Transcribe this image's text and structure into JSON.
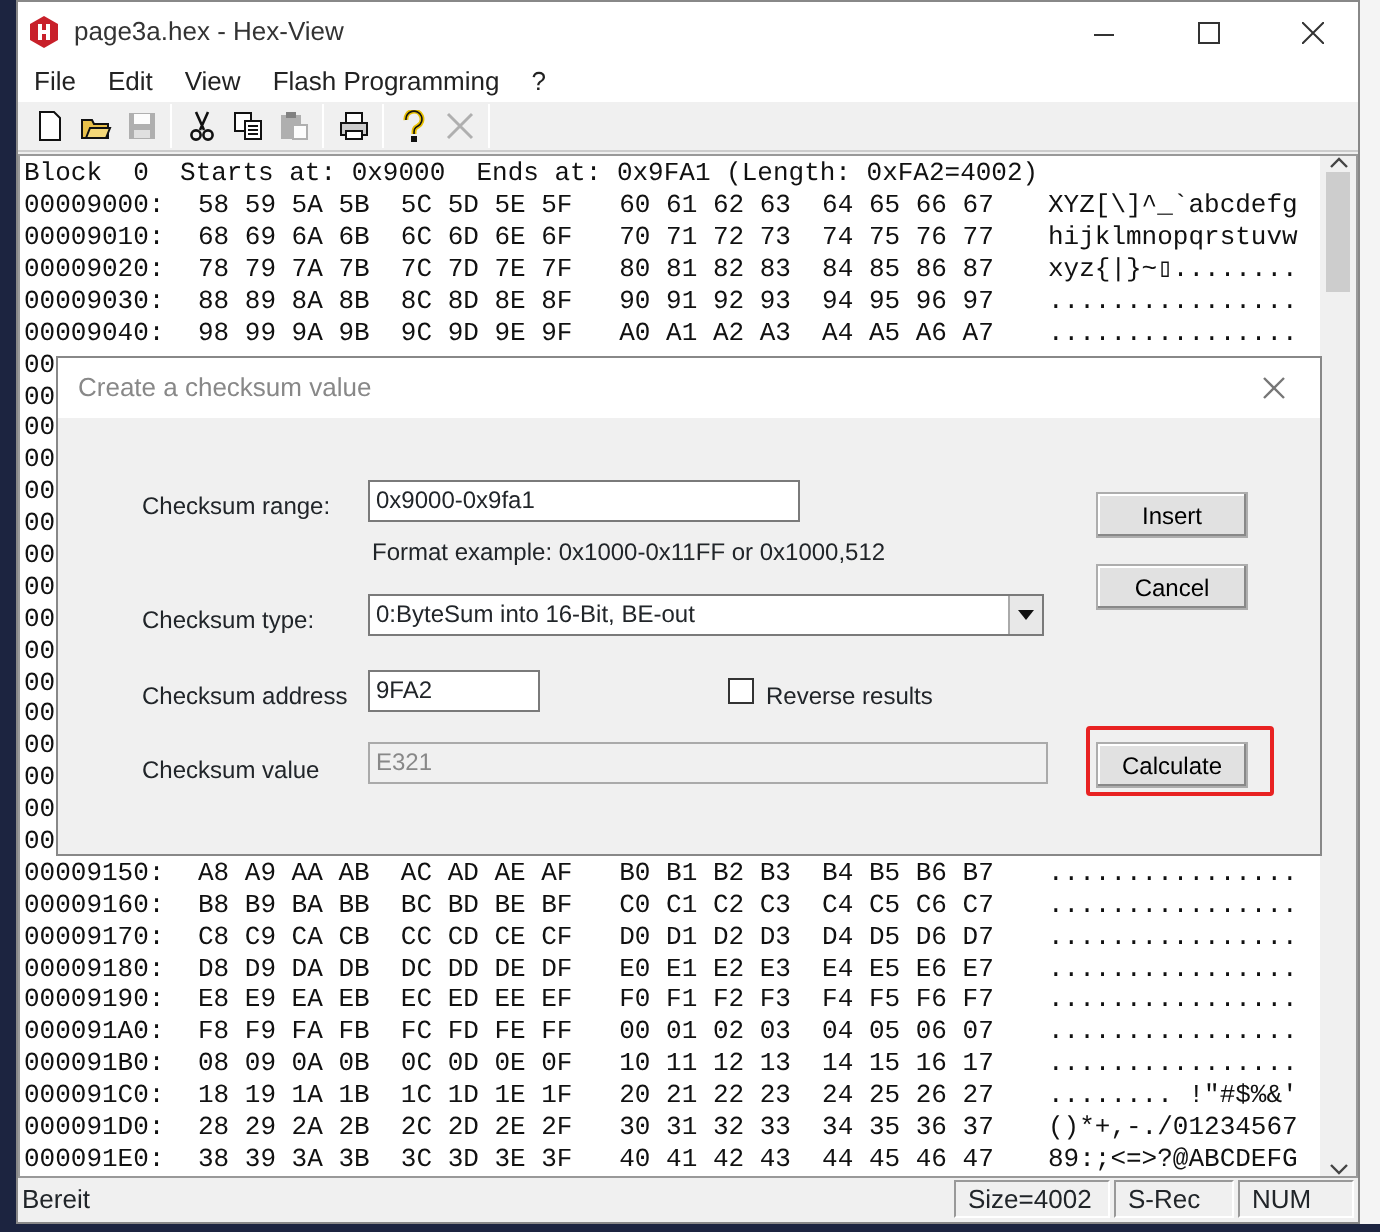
{
  "window": {
    "title": "page3a.hex - Hex-View"
  },
  "menu": [
    "File",
    "Edit",
    "View",
    "Flash Programming",
    "?"
  ],
  "toolbar": [
    {
      "disabled": false
    },
    {
      "disabled": false
    },
    {
      "disabled": true
    },
    {
      "disabled": false
    },
    {
      "disabled": false
    },
    {
      "disabled": true
    },
    {
      "disabled": false
    },
    {
      "disabled": false
    },
    {
      "disabled": true
    }
  ],
  "hex_view": {
    "header": "Block  0  Starts at: 0x9000  Ends at: 0x9FA1 (Length: 0xFA2=4002)",
    "rows": [
      {
        "address": "00009000:",
        "hex": "58 59 5A 5B  5C 5D 5E 5F   60 61 62 63  64 65 66 67",
        "ascii": "XYZ[\\]^_`abcdefg"
      },
      {
        "address": "00009010:",
        "hex": "68 69 6A 6B  6C 6D 6E 6F   70 71 72 73  74 75 76 77",
        "ascii": "hijklmnopqrstuvw"
      },
      {
        "address": "00009020:",
        "hex": "78 79 7A 7B  7C 7D 7E 7F   80 81 82 83  84 85 86 87",
        "ascii": "xyz{|}~▯........"
      },
      {
        "address": "00009030:",
        "hex": "88 89 8A 8B  8C 8D 8E 8F   90 91 92 93  94 95 96 97",
        "ascii": "................"
      },
      {
        "address": "00009040:",
        "hex": "98 99 9A 9B  9C 9D 9E 9F   A0 A1 A2 A3  A4 A5 A6 A7",
        "ascii": "................"
      },
      {
        "address": "00"
      },
      {
        "address": "00"
      },
      {
        "address": "00"
      },
      {
        "address": "00"
      },
      {
        "address": "00"
      },
      {
        "address": "00"
      },
      {
        "address": "00"
      },
      {
        "address": "00"
      },
      {
        "address": "00"
      },
      {
        "address": "00"
      },
      {
        "address": "00"
      },
      {
        "address": "00"
      },
      {
        "address": "00"
      },
      {
        "address": "00"
      },
      {
        "address": "00"
      },
      {
        "address": "00"
      },
      {
        "address": "00009150:",
        "hex": "A8 A9 AA AB  AC AD AE AF   B0 B1 B2 B3  B4 B5 B6 B7",
        "ascii": "................"
      },
      {
        "address": "00009160:",
        "hex": "B8 B9 BA BB  BC BD BE BF   C0 C1 C2 C3  C4 C5 C6 C7",
        "ascii": "................"
      },
      {
        "address": "00009170:",
        "hex": "C8 C9 CA CB  CC CD CE CF   D0 D1 D2 D3  D4 D5 D6 D7",
        "ascii": "................"
      },
      {
        "address": "00009180:",
        "hex": "D8 D9 DA DB  DC DD DE DF   E0 E1 E2 E3  E4 E5 E6 E7",
        "ascii": "................"
      },
      {
        "address": "00009190:",
        "hex": "E8 E9 EA EB  EC ED EE EF   F0 F1 F2 F3  F4 F5 F6 F7",
        "ascii": "................"
      },
      {
        "address": "000091A0:",
        "hex": "F8 F9 FA FB  FC FD FE FF   00 01 02 03  04 05 06 07",
        "ascii": "................"
      },
      {
        "address": "000091B0:",
        "hex": "08 09 0A 0B  0C 0D 0E 0F   10 11 12 13  14 15 16 17",
        "ascii": "................"
      },
      {
        "address": "000091C0:",
        "hex": "18 19 1A 1B  1C 1D 1E 1F   20 21 22 23  24 25 26 27",
        "ascii": "........ !\"#$%&'"
      },
      {
        "address": "000091D0:",
        "hex": "28 29 2A 2B  2C 2D 2E 2F   30 31 32 33  34 35 36 37",
        "ascii": "()*+,-./01234567"
      },
      {
        "address": "000091E0:",
        "hex": "38 39 3A 3B  3C 3D 3E 3F   40 41 42 43  44 45 46 47",
        "ascii": "89:;<=>?@ABCDEFG"
      }
    ]
  },
  "dialog": {
    "title": "Create a checksum value",
    "range": {
      "label": "Checksum range:",
      "value": "0x9000-0x9fa1"
    },
    "format_hint": "Format example: 0x1000-0x11FF or 0x1000,512",
    "type": {
      "label": "Checksum type:",
      "value": "0:ByteSum into 16-Bit, BE-out"
    },
    "address": {
      "label": "Checksum address",
      "value": "9FA2"
    },
    "reverse": {
      "label": "Reverse results",
      "checked": false
    },
    "value": {
      "label": "Checksum value",
      "value": "E321",
      "disabled": true
    },
    "buttons": [
      {
        "label": "Insert",
        "highlighted": false
      },
      {
        "label": "Cancel",
        "highlighted": false
      },
      {
        "label": "Calculate",
        "highlighted": true
      }
    ]
  },
  "status_bar": {
    "message": "Bereit",
    "panels": [
      "Size=4002",
      "S-Rec",
      "NUM"
    ]
  }
}
